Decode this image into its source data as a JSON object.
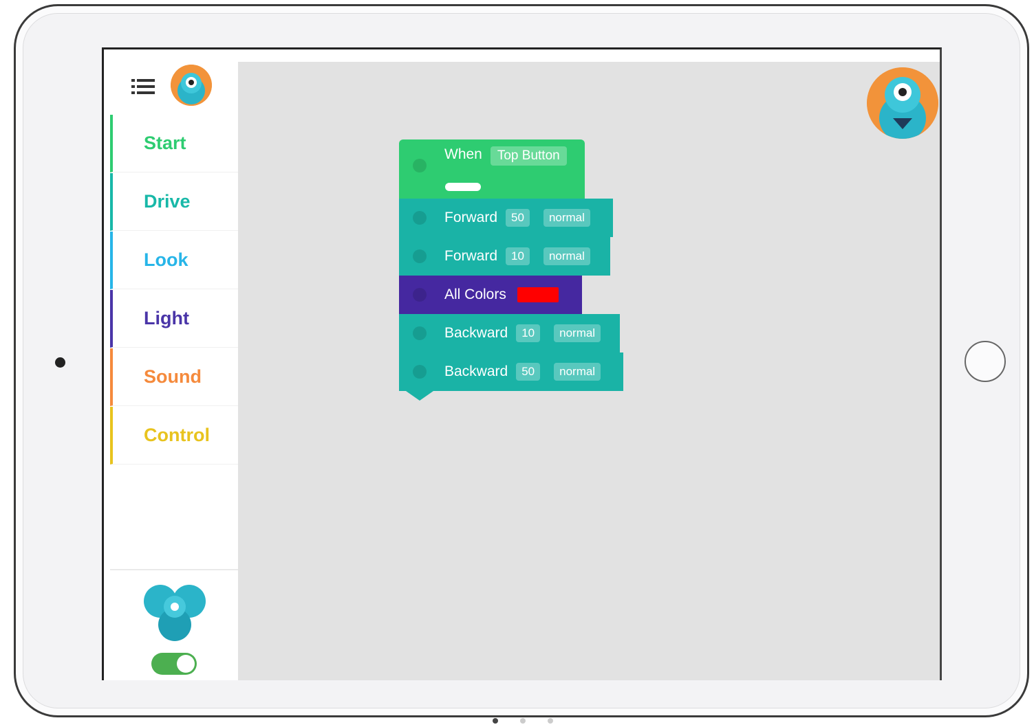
{
  "sidebar": {
    "categories": [
      {
        "label": "Start",
        "color": "#2ecc71"
      },
      {
        "label": "Drive",
        "color": "#18b8a8"
      },
      {
        "label": "Look",
        "color": "#27b5e8"
      },
      {
        "label": "Light",
        "color": "#4a35a8"
      },
      {
        "label": "Sound",
        "color": "#f58a3c"
      },
      {
        "label": "Control",
        "color": "#e8c31e"
      }
    ],
    "robot_connected": true
  },
  "blocks": {
    "start": {
      "label": "When",
      "trigger": "Top Button",
      "color": "#2ecc71"
    },
    "forward1": {
      "label": "Forward",
      "value": "50",
      "speed": "normal",
      "color": "#1ab3a6"
    },
    "forward2": {
      "label": "Forward",
      "value": "10",
      "speed": "normal",
      "color": "#1ab3a6"
    },
    "light": {
      "label": "All Colors",
      "swatch": "#ff0000",
      "color": "#4528a0"
    },
    "backward1": {
      "label": "Backward",
      "value": "10",
      "speed": "normal",
      "color": "#1ab3a6"
    },
    "backward2": {
      "label": "Backward",
      "value": "50",
      "speed": "normal",
      "color": "#1ab3a6"
    }
  },
  "icons": {
    "menu": "list-icon",
    "avatar": "dash-robot-avatar",
    "robot": "dash-robot-icon"
  }
}
